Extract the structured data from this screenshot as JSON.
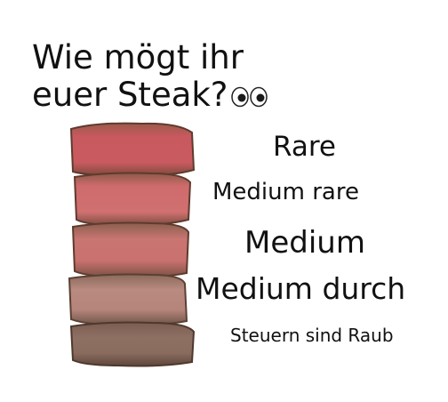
{
  "heading": {
    "line1": "Wie mögt ihr",
    "line2": "euer Steak?"
  },
  "icons": {
    "eyes": "eyes-emoji"
  },
  "levels": [
    "Rare",
    "Medium rare",
    "Medium",
    "Medium durch",
    "Steuern sind Raub"
  ],
  "colors": {
    "background": "#ffffff",
    "text": "#111111",
    "crust": "#6b4a36",
    "rare": "#c8595f",
    "medium_rare": "#cf6b6d",
    "medium": "#c97571",
    "medium_well": "#b98a80",
    "well_done": "#8e7063"
  }
}
